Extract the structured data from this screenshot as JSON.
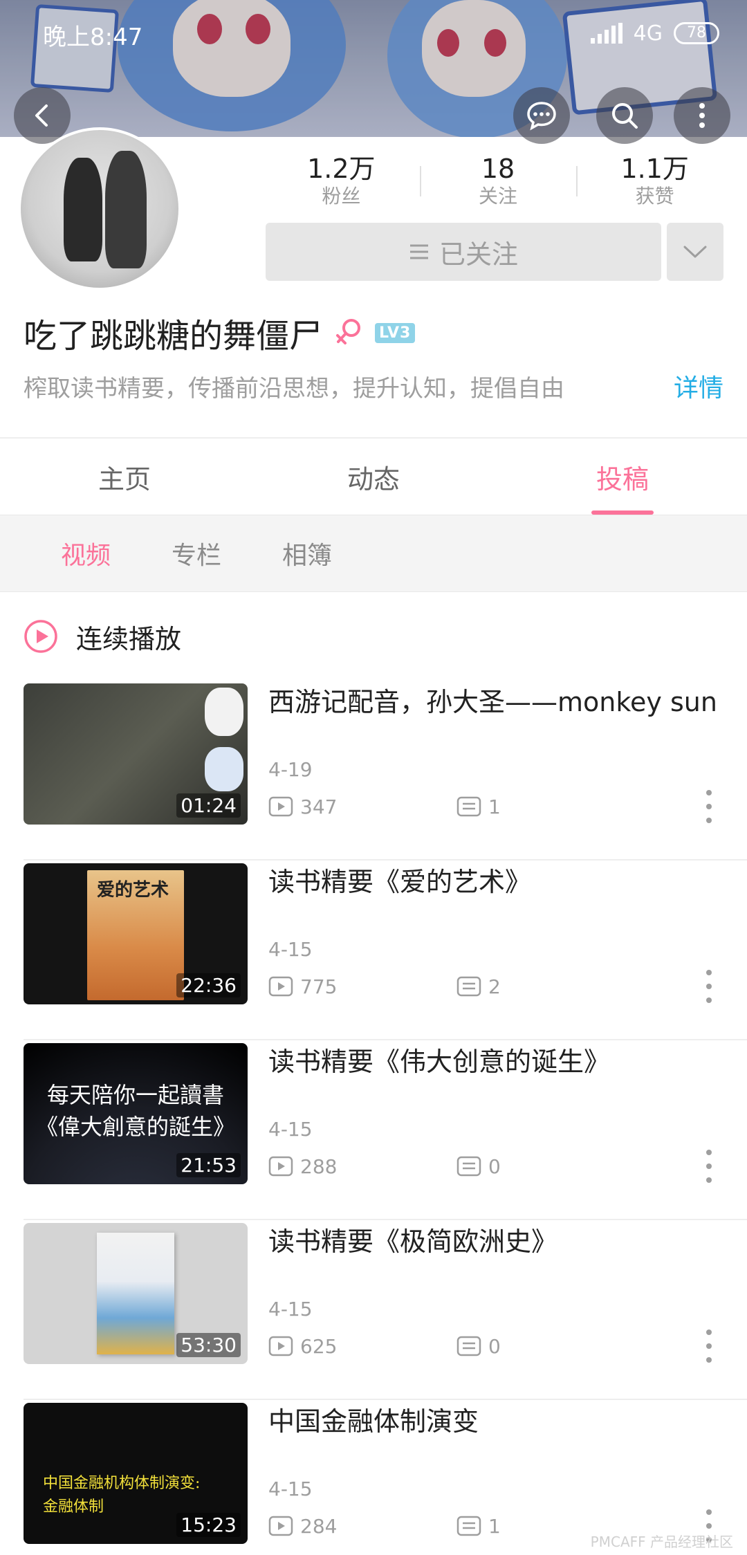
{
  "status_bar": {
    "time": "晚上8:47",
    "network": "4G",
    "battery": "78"
  },
  "header": {
    "back_icon": "chevron-left-icon",
    "message_icon": "chat-bubble-icon",
    "search_icon": "search-icon",
    "more_icon": "more-vertical-icon"
  },
  "profile": {
    "stats": [
      {
        "value": "1.2万",
        "label": "粉丝"
      },
      {
        "value": "18",
        "label": "关注"
      },
      {
        "value": "1.1万",
        "label": "获赞"
      }
    ],
    "follow_label": "已关注",
    "name": "吃了跳跳糖的舞僵尸",
    "gender_symbol": "♀",
    "level": "LV3",
    "bio": "榨取读书精要，传播前沿思想，提升认知，提倡自由",
    "details_label": "详情"
  },
  "tabs": [
    "主页",
    "动态",
    "投稿"
  ],
  "active_tab": "投稿",
  "subtabs": [
    "视频",
    "专栏",
    "相簿"
  ],
  "active_subtab": "视频",
  "autoplay_label": "连续播放",
  "videos": [
    {
      "title": "西游记配音，孙大圣——monkey  sun",
      "duration": "01:24",
      "date": "4-19",
      "views": "347",
      "comments": "1"
    },
    {
      "title": "读书精要《爱的艺术》",
      "duration": "22:36",
      "date": "4-15",
      "views": "775",
      "comments": "2",
      "thumb_text": "爱的艺术"
    },
    {
      "title": "读书精要《伟大创意的诞生》",
      "duration": "21:53",
      "date": "4-15",
      "views": "288",
      "comments": "0",
      "thumb_text": [
        "每天陪你一起讀書",
        "《偉大創意的誕生》"
      ]
    },
    {
      "title": "读书精要《极简欧洲史》",
      "duration": "53:30",
      "date": "4-15",
      "views": "625",
      "comments": "0"
    },
    {
      "title": "中国金融体制演变",
      "duration": "15:23",
      "date": "4-15",
      "views": "284",
      "comments": "1",
      "thumb_text": [
        "中国金融机构体制演变:",
        "金融体制"
      ]
    }
  ],
  "watermark": "PMCAFF 产品经理社区",
  "colors": {
    "accent_pink": "#fb7299",
    "link_blue": "#23ade5",
    "level_badge": "#8fd3e8"
  }
}
